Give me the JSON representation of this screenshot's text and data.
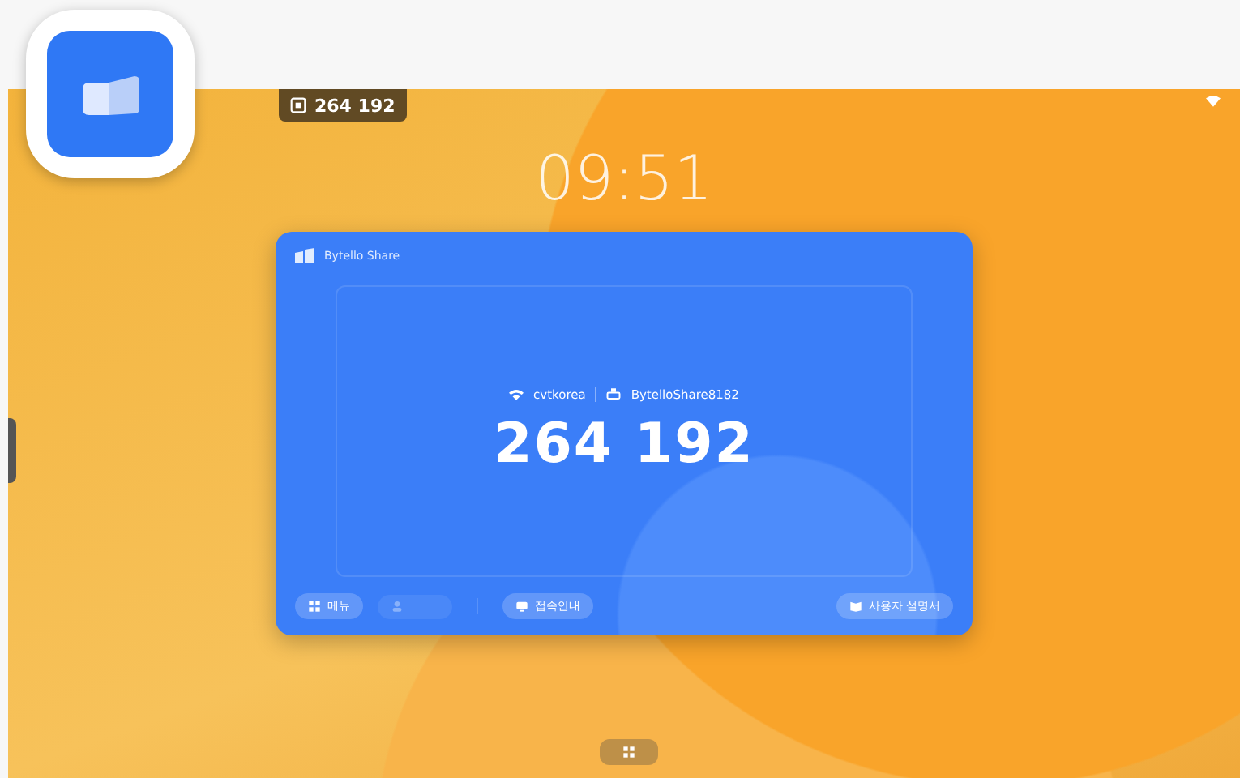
{
  "top_chip": {
    "code": "264 192"
  },
  "clock": "09:51",
  "card": {
    "title": "Bytello Share",
    "network": "cvtkorea",
    "device": "BytelloShare8182",
    "code": "264 192",
    "buttons": [
      {
        "label": "메뉴",
        "kind": "grid",
        "disabled": false
      },
      {
        "kind": "person",
        "disabled": true
      },
      {
        "label": "접속안내",
        "kind": "cast",
        "disabled": false
      }
    ],
    "right_button": {
      "label": "사용자 설명서",
      "kind": "book",
      "disabled": false
    }
  }
}
